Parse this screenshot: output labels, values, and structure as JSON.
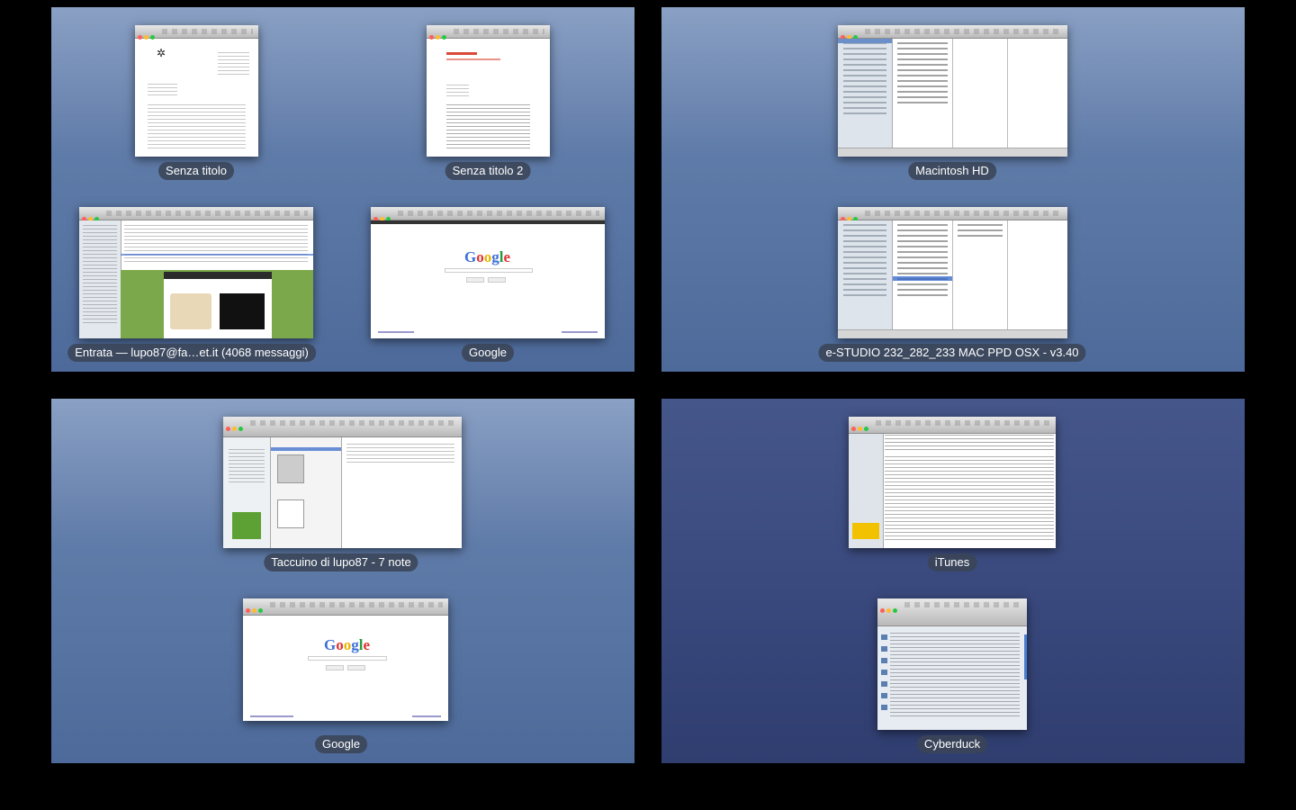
{
  "spaces": [
    {
      "windows": [
        {
          "title": "Senza titolo"
        },
        {
          "title": "Senza titolo 2"
        },
        {
          "title": "Entrata — lupo87@fa…et.it (4068 messaggi)"
        },
        {
          "title": "Google"
        }
      ]
    },
    {
      "windows": [
        {
          "title": "Macintosh HD"
        },
        {
          "title": "e-STUDIO 232_282_233 MAC PPD OSX - v3.40"
        }
      ]
    },
    {
      "windows": [
        {
          "title": "Taccuino di lupo87 - 7 note"
        },
        {
          "title": "Google"
        }
      ]
    },
    {
      "windows": [
        {
          "title": "iTunes"
        },
        {
          "title": "Cyberduck"
        }
      ]
    }
  ],
  "google_logo": [
    "G",
    "o",
    "o",
    "g",
    "l",
    "e"
  ],
  "colors": {
    "space_blue": "#5f7ba8",
    "space_dark": "#3a4a7e",
    "label_bg": "#3a4456",
    "background": "#000000"
  }
}
